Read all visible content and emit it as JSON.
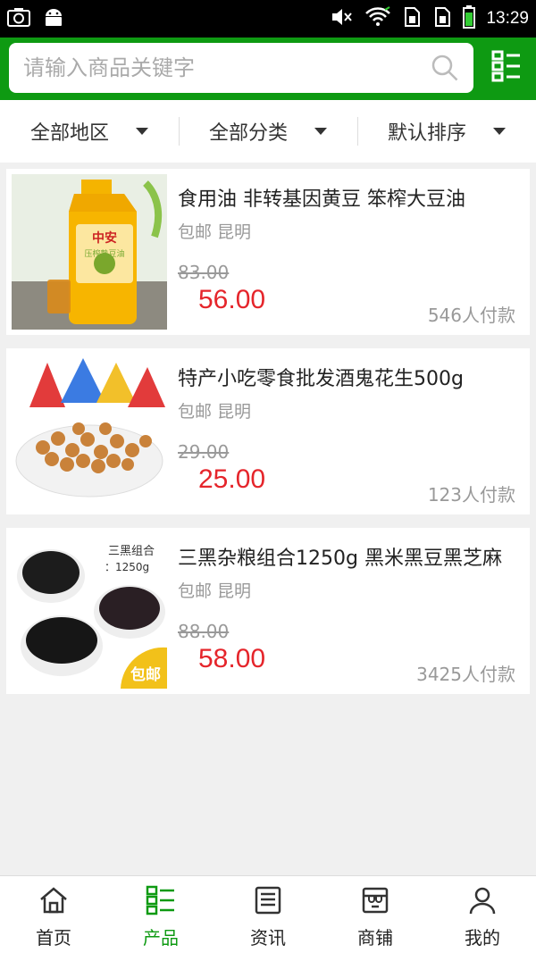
{
  "status_bar": {
    "time": "13:29",
    "icons": [
      "screenshot-icon",
      "android-icon",
      "mute-icon",
      "wifi-icon",
      "sim1-icon",
      "sim2-icon",
      "battery-icon"
    ]
  },
  "search": {
    "placeholder": "请输入商品关键字",
    "value": ""
  },
  "filters": [
    {
      "label": "全部地区"
    },
    {
      "label": "全部分类"
    },
    {
      "label": "默认排序"
    }
  ],
  "products": [
    {
      "title": "食用油 非转基因黄豆 笨榨大豆油",
      "meta": "包邮 昆明",
      "old_price": "83.00",
      "price": "56.00",
      "sold": "546人付款",
      "thumb_text": "中安",
      "thumb_sub": "压榨熟豆油"
    },
    {
      "title": "特产小吃零食批发酒鬼花生500g",
      "meta": "包邮 昆明",
      "old_price": "29.00",
      "price": "25.00",
      "sold": "123人付款"
    },
    {
      "title": "三黑杂粮组合1250g 黑米黑豆黑芝麻",
      "meta": "包邮 昆明",
      "old_price": "88.00",
      "price": "58.00",
      "sold": "3425人付款",
      "thumb_text": "三黑组合",
      "thumb_sub": "：1250g",
      "badge": "包邮"
    }
  ],
  "nav": [
    {
      "label": "首页"
    },
    {
      "label": "产品"
    },
    {
      "label": "资讯"
    },
    {
      "label": "商铺"
    },
    {
      "label": "我的"
    }
  ],
  "colors": {
    "brand": "#0e9a12",
    "price": "#e5252b"
  }
}
